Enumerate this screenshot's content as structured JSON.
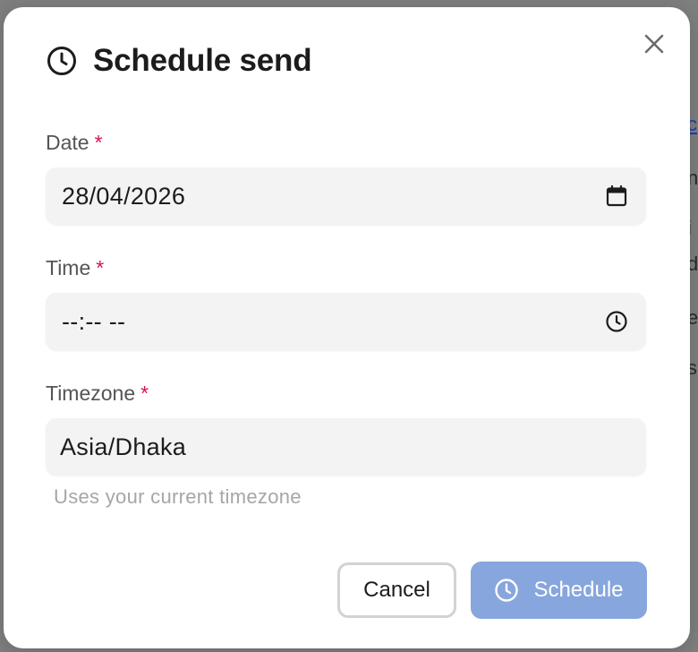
{
  "background": {
    "fragments": [
      "c",
      "n",
      "i",
      "d",
      "e",
      "s"
    ]
  },
  "dialog": {
    "title": "Schedule send",
    "title_icon": "clock-icon",
    "close_icon": "close-icon"
  },
  "fields": {
    "date": {
      "label": "Date",
      "required_mark": "*",
      "value": "28/04/2026",
      "icon": "calendar-icon"
    },
    "time": {
      "label": "Time",
      "required_mark": "*",
      "value": "--:-- --",
      "icon": "clock-icon"
    },
    "timezone": {
      "label": "Timezone",
      "required_mark": "*",
      "value": "Asia/Dhaka",
      "hint": "Uses your current timezone"
    }
  },
  "actions": {
    "cancel_label": "Cancel",
    "schedule_label": "Schedule",
    "schedule_icon": "clock-icon"
  },
  "colors": {
    "accent_disabled": "#87a6dd",
    "required": "#d4145a"
  }
}
